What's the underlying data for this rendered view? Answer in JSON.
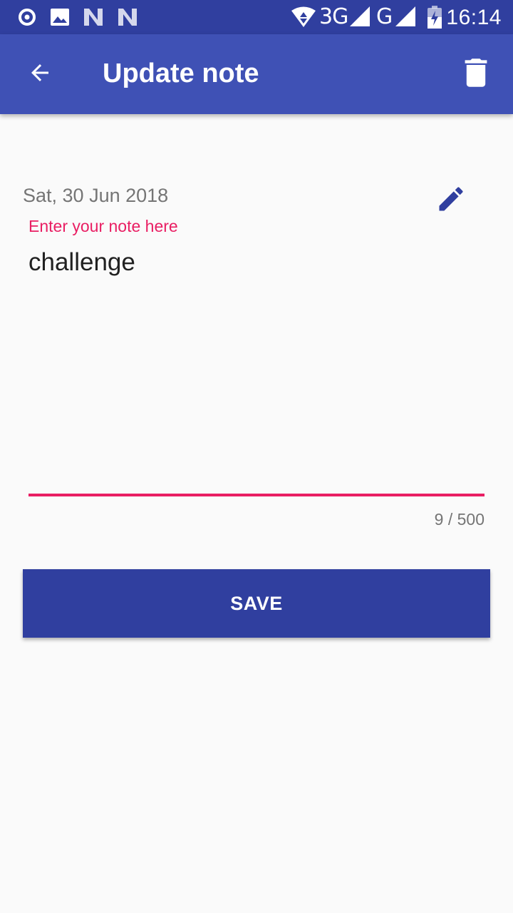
{
  "status_bar": {
    "time": "16:14",
    "network_1": "3G",
    "network_2": "G",
    "icons": [
      "record-icon",
      "image-icon",
      "n-notification-icon",
      "n-notification-icon",
      "wifi-data-icon",
      "signal-icon",
      "signal-icon",
      "battery-charging-icon"
    ]
  },
  "app_bar": {
    "title": "Update note",
    "back_icon": "arrow-back-icon",
    "delete_icon": "trash-icon"
  },
  "note": {
    "date": "Sat, 30 Jun 2018",
    "edit_icon": "pencil-icon",
    "hint": "Enter your note here",
    "value": "challenge",
    "counter": "9 / 500"
  },
  "actions": {
    "save_label": "SAVE"
  },
  "colors": {
    "primary": "#3F51B5",
    "primary_dark": "#303F9F",
    "accent": "#E91E63",
    "background": "#FAFAFA"
  }
}
